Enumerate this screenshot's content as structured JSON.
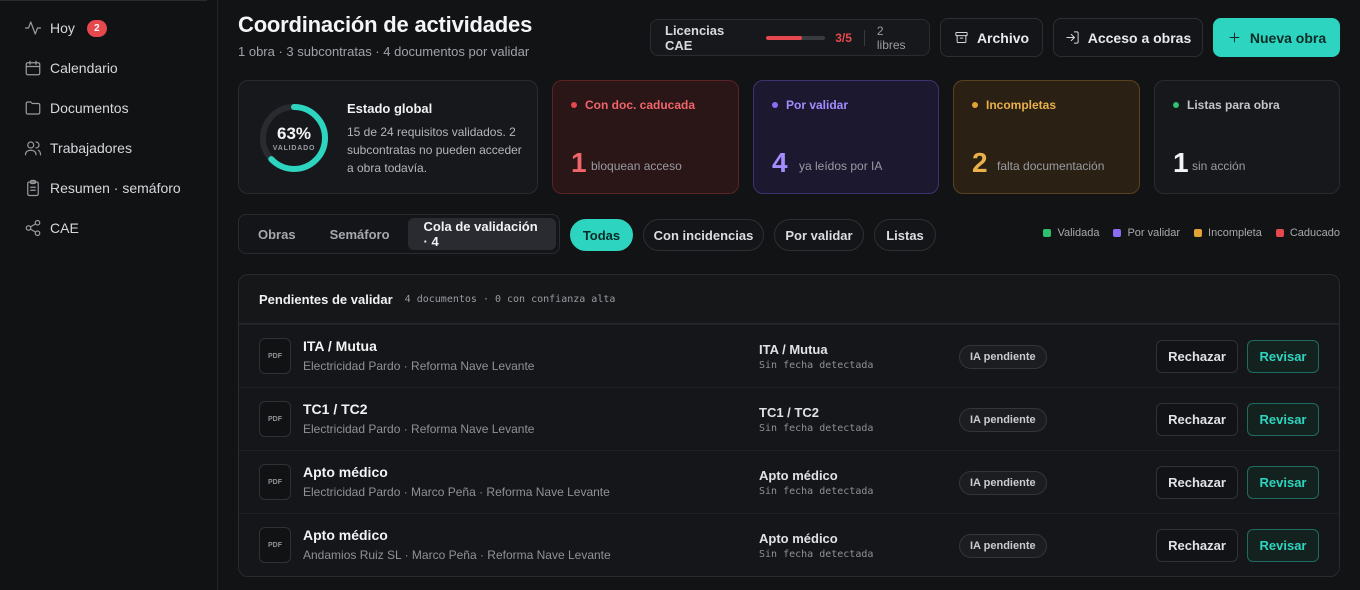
{
  "sidebar": {
    "items": [
      {
        "label": "Hoy",
        "icon": "activity-icon",
        "badge": "2"
      },
      {
        "label": "Calendario",
        "icon": "calendar-icon"
      },
      {
        "label": "Documentos",
        "icon": "folder-icon"
      },
      {
        "label": "Trabajadores",
        "icon": "users-icon"
      },
      {
        "label": "Resumen · semáforo",
        "icon": "clipboard-icon"
      },
      {
        "label": "CAE",
        "icon": "share-icon"
      }
    ]
  },
  "header": {
    "title": "Coordinación de actividades",
    "subtitle": "1 obra · 3 subcontratas · 4 documentos por validar",
    "licenses": {
      "label": "Licencias CAE",
      "count": "3/5",
      "free": "2 libres",
      "used_fraction": 0.6
    },
    "archive_label": "Archivo",
    "access_label": "Acceso a obras",
    "new_label": "Nueva obra"
  },
  "global": {
    "percent": "63%",
    "percent_value": 0.63,
    "ring_label": "VALIDADO",
    "title": "Estado global",
    "text": "15 de 24 requisitos validados. 2 subcontratas no pueden acceder a obra todavía."
  },
  "stats": [
    {
      "label": "Con doc. caducada",
      "value": "1",
      "desc": "bloquean acceso",
      "color": "#e5484d"
    },
    {
      "label": "Por validar",
      "value": "4",
      "desc": "ya leídos por IA",
      "color": "#8b6cf6"
    },
    {
      "label": "Incompletas",
      "value": "2",
      "desc": "falta documentación",
      "color": "#e2a336"
    },
    {
      "label": "Listas para obra",
      "value": "1",
      "desc": "sin acción",
      "color": "#2fbf71"
    }
  ],
  "tabs": [
    "Obras",
    "Semáforo",
    "Cola de validación · 4"
  ],
  "filters": [
    "Todas",
    "Con incidencias",
    "Por validar",
    "Listas"
  ],
  "legend": [
    {
      "label": "Validada",
      "color": "#2fbf71"
    },
    {
      "label": "Por validar",
      "color": "#8b6cf6"
    },
    {
      "label": "Incompleta",
      "color": "#e2a336"
    },
    {
      "label": "Caducado",
      "color": "#e5484d"
    }
  ],
  "queue": {
    "title": "Pendientes de validar",
    "meta": "4 documentos · 0 con confianza alta",
    "file_badge": "PDF",
    "status": "IA pendiente",
    "reject_label": "Rechazar",
    "review_label": "Revisar",
    "rows": [
      {
        "title": "ITA / Mutua",
        "sub": "Electricidad Pardo · Reforma Nave Levante",
        "type": "ITA / Mutua",
        "date": "Sin fecha detectada"
      },
      {
        "title": "TC1 / TC2",
        "sub": "Electricidad Pardo · Reforma Nave Levante",
        "type": "TC1 / TC2",
        "date": "Sin fecha detectada"
      },
      {
        "title": "Apto médico",
        "sub": "Electricidad Pardo · Marco Peña · Reforma Nave Levante",
        "type": "Apto médico",
        "date": "Sin fecha detectada"
      },
      {
        "title": "Apto médico",
        "sub": "Andamios Ruiz SL · Marco Peña · Reforma Nave Levante",
        "type": "Apto médico",
        "date": "Sin fecha detectada"
      }
    ]
  }
}
